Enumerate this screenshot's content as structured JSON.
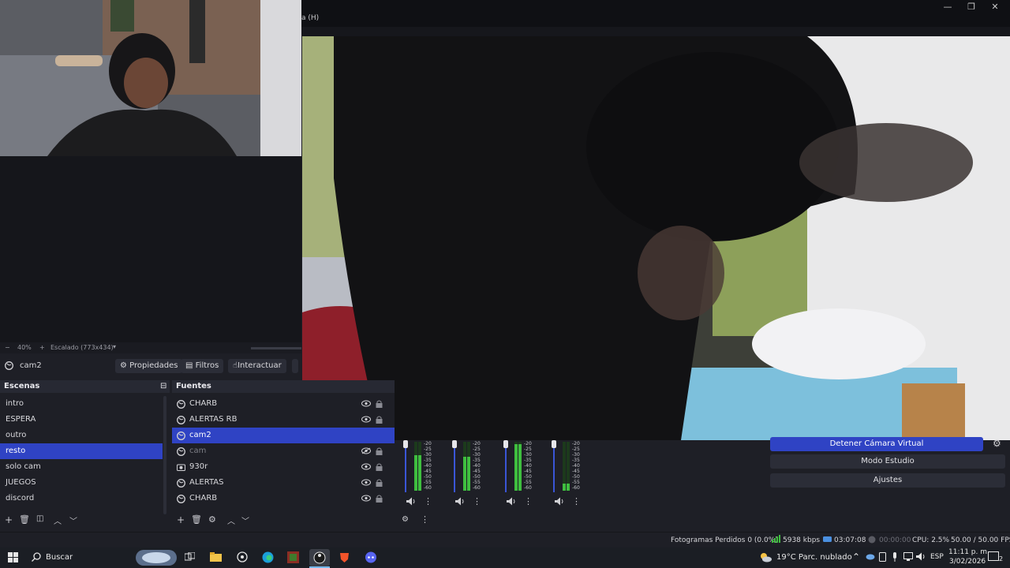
{
  "window": {
    "menu_hint": "a (H)",
    "controls": [
      "—",
      "❐",
      "✕"
    ]
  },
  "preview": {
    "zoom": "40%",
    "scale_label": "Escalado (773x434)"
  },
  "source_toolbar": {
    "current_source": "cam2",
    "properties": "Propiedades",
    "filters": "Filtros",
    "interact": "Interactuar"
  },
  "scenes": {
    "title": "Escenas",
    "items": [
      "intro",
      "ESPERA",
      "outro",
      "resto",
      "solo cam",
      "JUEGOS",
      "discord"
    ],
    "selected": "resto"
  },
  "sources": {
    "title": "Fuentes",
    "items": [
      {
        "label": "CHARB",
        "icon": "globe-icon",
        "state": "normal"
      },
      {
        "label": "ALERTAS RB",
        "icon": "globe-icon",
        "state": "normal"
      },
      {
        "label": "cam2",
        "icon": "globe-icon",
        "state": "selected"
      },
      {
        "label": "cam",
        "icon": "globe-icon",
        "state": "hidden"
      },
      {
        "label": "930r",
        "icon": "camera-icon",
        "state": "normal"
      },
      {
        "label": "ALERTAS",
        "icon": "globe-icon",
        "state": "normal"
      },
      {
        "label": "CHARB",
        "icon": "globe-icon",
        "state": "normal"
      }
    ]
  },
  "mixer": {
    "ticks": [
      "-20",
      "-25",
      "-30",
      "-35",
      "-40",
      "-45",
      "-50",
      "-55",
      "-60"
    ]
  },
  "controls": {
    "virtual_camera": "Detener Cámara Virtual",
    "studio_mode": "Modo Estudio",
    "settings": "Ajustes"
  },
  "status": {
    "dropped": "Fotogramas Perdidos 0 (0.0%)",
    "bitrate": "5938 kbps",
    "stream_time": "03:07:08",
    "rec_time": "00:00:00",
    "cpu": "CPU: 2.5%",
    "fps": "50.00 / 50.00 FPS"
  },
  "taskbar": {
    "search": "Buscar",
    "weather": "19°C  Parc. nublado",
    "lang": "ESP",
    "time": "11:11 p. m.",
    "date": "3/02/2026",
    "notifications": "2"
  },
  "colors": {
    "accent": "#2f43c4",
    "panel": "#1e1f26",
    "meter_green": "#3fbf3f"
  }
}
